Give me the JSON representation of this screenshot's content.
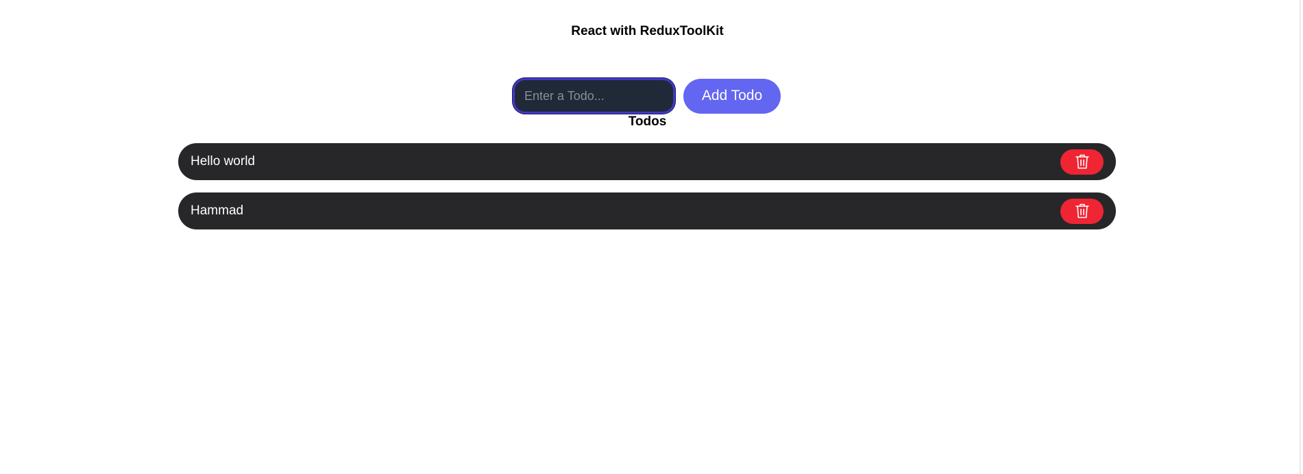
{
  "header": {
    "title": "React with ReduxToolKit"
  },
  "form": {
    "input_value": "",
    "input_placeholder": "Enter a Todo...",
    "add_label": "Add Todo"
  },
  "todos": {
    "heading": "Todos",
    "items": [
      {
        "text": "Hello world",
        "delete_icon": "trash-icon"
      },
      {
        "text": "Hammad",
        "delete_icon": "trash-icon"
      }
    ]
  },
  "colors": {
    "background": "#ffffff",
    "input_background": "#1f2937",
    "input_border": "#4338ca",
    "add_button": "#6366f1",
    "todo_item": "#27272a",
    "delete_button": "#ef2533"
  }
}
